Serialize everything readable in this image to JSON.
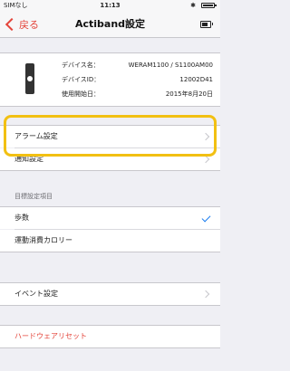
{
  "status_bar": {
    "carrier": "SIMなし",
    "time": "11:13",
    "bluetooth_icon": "bluetooth-icon"
  },
  "nav": {
    "back_label": "戻る",
    "title": "Actiband設定",
    "right_icon": "battery-icon"
  },
  "device": {
    "name_label": "デバイス名：",
    "name_value": "WERAM1100 / S1100AM00",
    "id_label": "デバイスID：",
    "id_value": "12002D41",
    "start_label": "使用開始日：",
    "start_value": "2015年8月20日"
  },
  "settings": {
    "alarm": "アラーム設定",
    "notification": "通知設定"
  },
  "goal": {
    "header": "目標設定項目",
    "steps": "歩数",
    "calories": "運動消費カロリー"
  },
  "event": {
    "label": "イベント設定"
  },
  "hardware_reset": {
    "label": "ハードウェアリセット"
  },
  "colors": {
    "accent": "#e4453b",
    "highlight": "#f2c012",
    "check": "#1a7cf0"
  }
}
